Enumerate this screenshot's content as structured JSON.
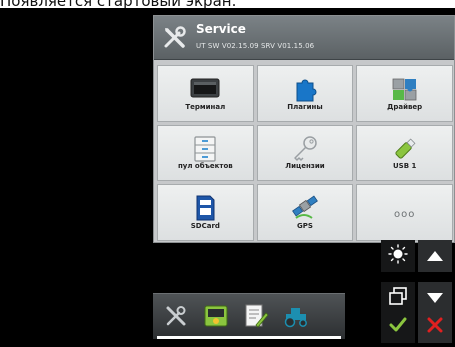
{
  "caption": "Появляется стартовый экран.",
  "header": {
    "title": "Service",
    "version": "UT SW V02.15.09 SRV V01.15.06"
  },
  "tiles": [
    {
      "label": "Терминал",
      "icon": "terminal-icon"
    },
    {
      "label": "Плагины",
      "icon": "plugins-icon"
    },
    {
      "label": "Драйвер",
      "icon": "driver-icon"
    },
    {
      "label": "пул объектов",
      "icon": "object-pool-icon"
    },
    {
      "label": "Лицензии",
      "icon": "key-icon"
    },
    {
      "label": "USB 1",
      "icon": "usb-icon"
    },
    {
      "label": "SDCard",
      "icon": "sdcard-icon"
    },
    {
      "label": "GPS",
      "icon": "satellite-icon"
    },
    {
      "label": "",
      "more": "ooo",
      "icon": "more-icon"
    }
  ],
  "side_buttons": [
    "brightness-icon",
    "up-arrow-icon",
    "window-switch-icon",
    "down-arrow-icon",
    "confirm-check-icon",
    "cancel-x-icon"
  ],
  "taskbar": [
    "service-tools-icon",
    "terminal-app-icon",
    "settings-doc-icon",
    "tractor-icon"
  ],
  "colors": {
    "accent_green": "#8bc53f",
    "cancel_red": "#e02020",
    "plugin_blue": "#1976c8"
  }
}
